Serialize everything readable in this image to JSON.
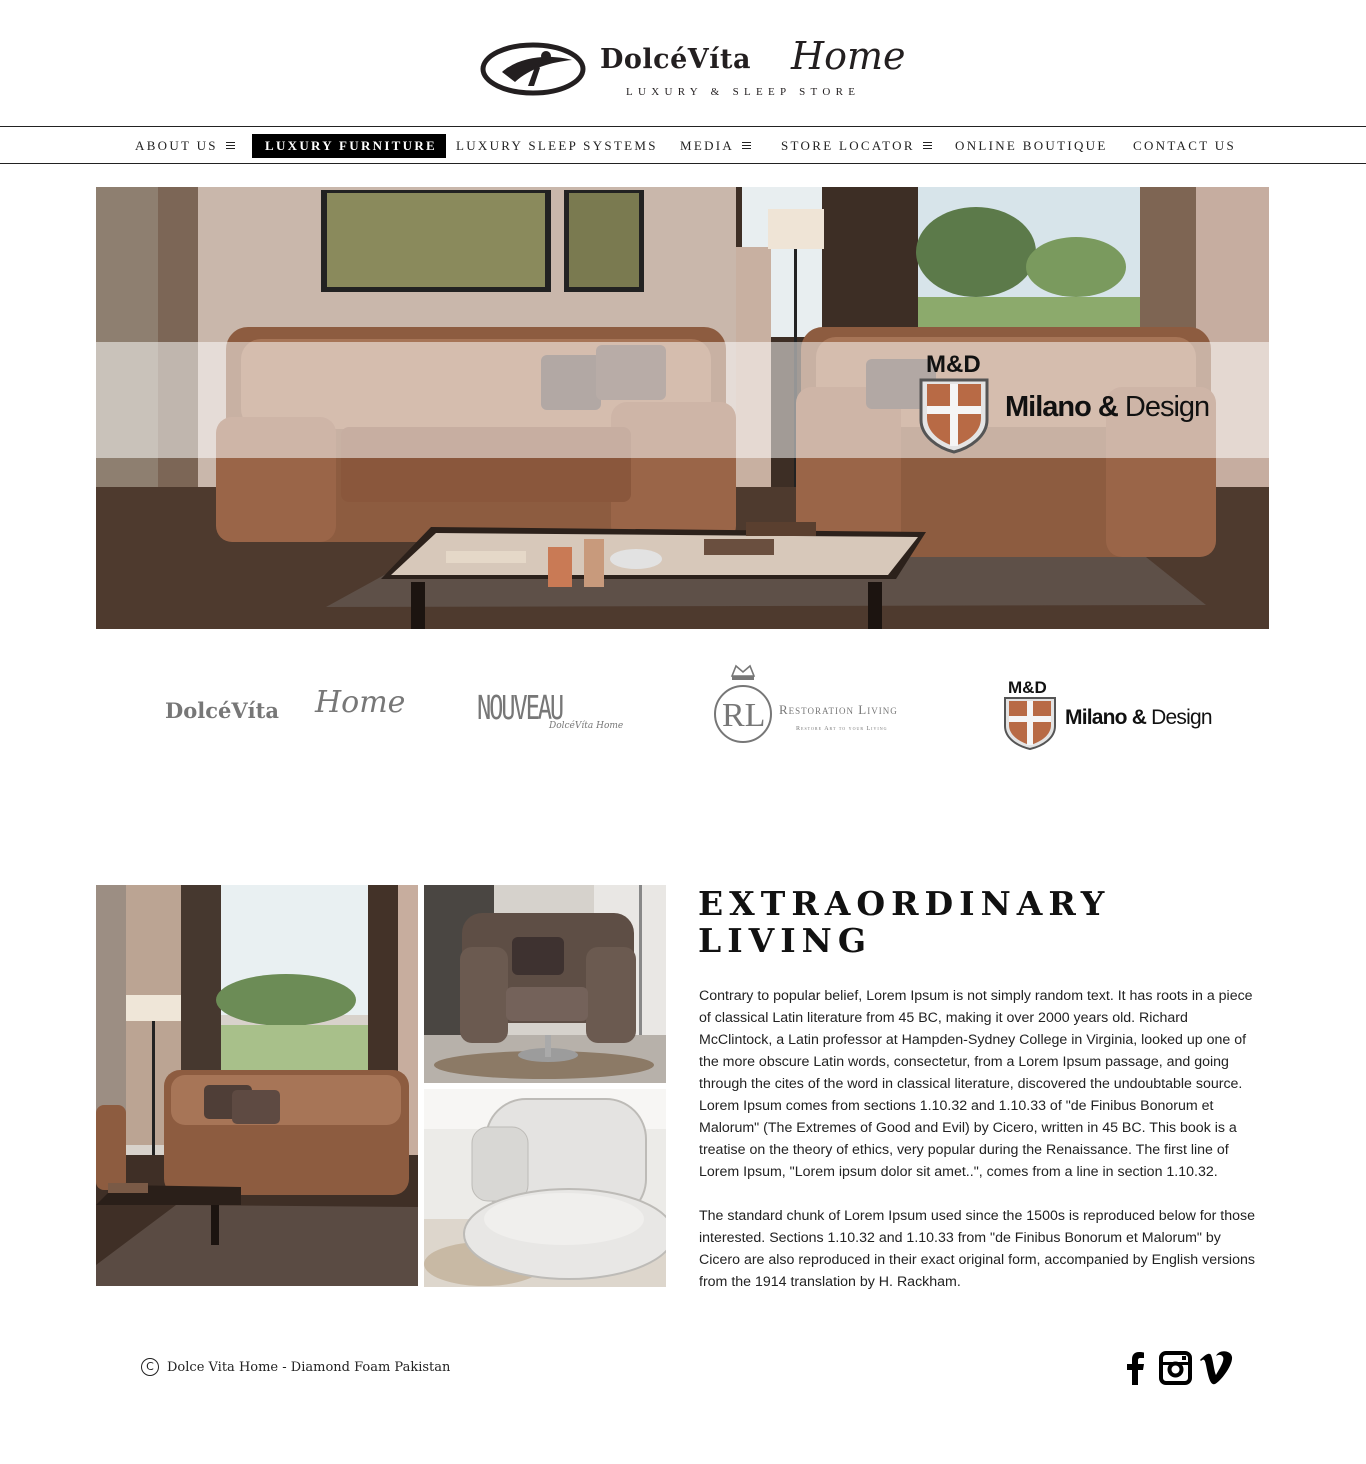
{
  "brand": {
    "wordmark": "DolcéVíta",
    "script": "Home",
    "tagline": "LUXURY & SLEEP STORE"
  },
  "nav": {
    "items": [
      {
        "label": "ABOUT US",
        "has_menu": true
      },
      {
        "label": "LUXURY FURNITURE",
        "active": true
      },
      {
        "label": "LUXURY SLEEP SYSTEMS"
      },
      {
        "label": "MEDIA",
        "has_menu": true
      },
      {
        "label": "STORE LOCATOR",
        "has_menu": true
      },
      {
        "label": "ONLINE BOUTIQUE"
      },
      {
        "label": "CONTACT US"
      }
    ]
  },
  "hero": {
    "badge": "M&D",
    "brand_bold": "Milano &",
    "brand_light": " Design"
  },
  "partners": {
    "dolcevita": {
      "word": "DolcéVíta",
      "script": "Home"
    },
    "nouveau": {
      "word": "NOUVEAU",
      "sub": "DolcéVíta Home"
    },
    "restoration": {
      "monogram": "RL",
      "word": "Restoration Living",
      "sub": "Restore Art to your Living"
    },
    "milano": {
      "badge": "M&D",
      "bold": "Milano &",
      "light": " Design"
    }
  },
  "feature": {
    "title_line1": "EXTRAORDINARY",
    "title_line2": "LIVING",
    "paragraph1": "Contrary to popular belief, Lorem Ipsum is not simply random text. It has roots in a piece of classical Latin literature from 45 BC, making it over 2000 years old. Richard McClintock, a Latin professor at Hampden-Sydney College in Virginia, looked up one of the more obscure Latin words, consectetur, from a Lorem Ipsum passage, and going through the cites of the word in classical literature, discovered the undoubtable source. Lorem Ipsum comes from sections 1.10.32 and 1.10.33 of \"de Finibus Bonorum et Malorum\" (The Extremes of Good and Evil) by Cicero, written in 45 BC. This book is a treatise on the theory of ethics, very popular during the Renaissance. The first line of Lorem Ipsum, \"Lorem ipsum dolor sit amet..\", comes from a line in section 1.10.32.",
    "paragraph2": "The standard chunk of Lorem Ipsum used since the 1500s is reproduced below for those interested. Sections 1.10.32 and 1.10.33 from \"de Finibus Bonorum et Malorum\" by Cicero are also reproduced in their exact original form, accompanied by English versions from the 1914 translation by H. Rackham."
  },
  "footer": {
    "copyright_symbol": "C",
    "copyright": "Dolce Vita Home - Diamond Foam Pakistan",
    "social": [
      "facebook-icon",
      "instagram-icon",
      "vimeo-icon"
    ]
  },
  "colors": {
    "accent": "#000000",
    "leather": "#8a5438",
    "shield": "#b86a45"
  }
}
